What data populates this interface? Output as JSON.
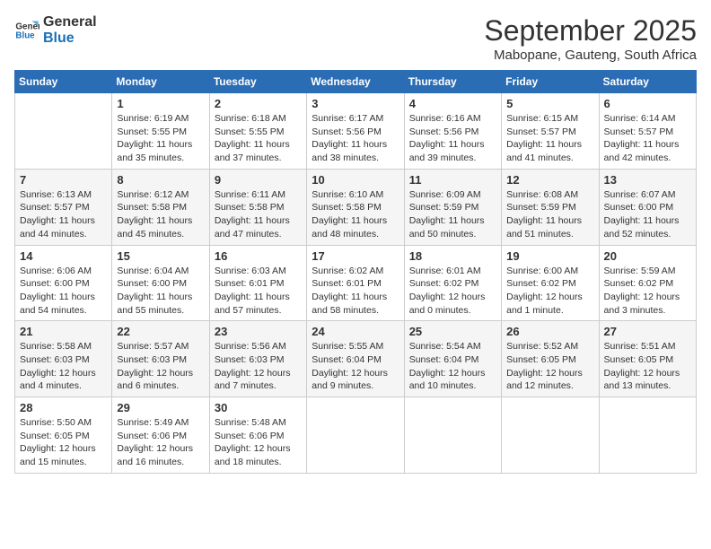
{
  "logo": {
    "line1": "General",
    "line2": "Blue"
  },
  "title": "September 2025",
  "location": "Mabopane, Gauteng, South Africa",
  "weekdays": [
    "Sunday",
    "Monday",
    "Tuesday",
    "Wednesday",
    "Thursday",
    "Friday",
    "Saturday"
  ],
  "weeks": [
    [
      {
        "day": "",
        "info": ""
      },
      {
        "day": "1",
        "info": "Sunrise: 6:19 AM\nSunset: 5:55 PM\nDaylight: 11 hours\nand 35 minutes."
      },
      {
        "day": "2",
        "info": "Sunrise: 6:18 AM\nSunset: 5:55 PM\nDaylight: 11 hours\nand 37 minutes."
      },
      {
        "day": "3",
        "info": "Sunrise: 6:17 AM\nSunset: 5:56 PM\nDaylight: 11 hours\nand 38 minutes."
      },
      {
        "day": "4",
        "info": "Sunrise: 6:16 AM\nSunset: 5:56 PM\nDaylight: 11 hours\nand 39 minutes."
      },
      {
        "day": "5",
        "info": "Sunrise: 6:15 AM\nSunset: 5:57 PM\nDaylight: 11 hours\nand 41 minutes."
      },
      {
        "day": "6",
        "info": "Sunrise: 6:14 AM\nSunset: 5:57 PM\nDaylight: 11 hours\nand 42 minutes."
      }
    ],
    [
      {
        "day": "7",
        "info": "Sunrise: 6:13 AM\nSunset: 5:57 PM\nDaylight: 11 hours\nand 44 minutes."
      },
      {
        "day": "8",
        "info": "Sunrise: 6:12 AM\nSunset: 5:58 PM\nDaylight: 11 hours\nand 45 minutes."
      },
      {
        "day": "9",
        "info": "Sunrise: 6:11 AM\nSunset: 5:58 PM\nDaylight: 11 hours\nand 47 minutes."
      },
      {
        "day": "10",
        "info": "Sunrise: 6:10 AM\nSunset: 5:58 PM\nDaylight: 11 hours\nand 48 minutes."
      },
      {
        "day": "11",
        "info": "Sunrise: 6:09 AM\nSunset: 5:59 PM\nDaylight: 11 hours\nand 50 minutes."
      },
      {
        "day": "12",
        "info": "Sunrise: 6:08 AM\nSunset: 5:59 PM\nDaylight: 11 hours\nand 51 minutes."
      },
      {
        "day": "13",
        "info": "Sunrise: 6:07 AM\nSunset: 6:00 PM\nDaylight: 11 hours\nand 52 minutes."
      }
    ],
    [
      {
        "day": "14",
        "info": "Sunrise: 6:06 AM\nSunset: 6:00 PM\nDaylight: 11 hours\nand 54 minutes."
      },
      {
        "day": "15",
        "info": "Sunrise: 6:04 AM\nSunset: 6:00 PM\nDaylight: 11 hours\nand 55 minutes."
      },
      {
        "day": "16",
        "info": "Sunrise: 6:03 AM\nSunset: 6:01 PM\nDaylight: 11 hours\nand 57 minutes."
      },
      {
        "day": "17",
        "info": "Sunrise: 6:02 AM\nSunset: 6:01 PM\nDaylight: 11 hours\nand 58 minutes."
      },
      {
        "day": "18",
        "info": "Sunrise: 6:01 AM\nSunset: 6:02 PM\nDaylight: 12 hours\nand 0 minutes."
      },
      {
        "day": "19",
        "info": "Sunrise: 6:00 AM\nSunset: 6:02 PM\nDaylight: 12 hours\nand 1 minute."
      },
      {
        "day": "20",
        "info": "Sunrise: 5:59 AM\nSunset: 6:02 PM\nDaylight: 12 hours\nand 3 minutes."
      }
    ],
    [
      {
        "day": "21",
        "info": "Sunrise: 5:58 AM\nSunset: 6:03 PM\nDaylight: 12 hours\nand 4 minutes."
      },
      {
        "day": "22",
        "info": "Sunrise: 5:57 AM\nSunset: 6:03 PM\nDaylight: 12 hours\nand 6 minutes."
      },
      {
        "day": "23",
        "info": "Sunrise: 5:56 AM\nSunset: 6:03 PM\nDaylight: 12 hours\nand 7 minutes."
      },
      {
        "day": "24",
        "info": "Sunrise: 5:55 AM\nSunset: 6:04 PM\nDaylight: 12 hours\nand 9 minutes."
      },
      {
        "day": "25",
        "info": "Sunrise: 5:54 AM\nSunset: 6:04 PM\nDaylight: 12 hours\nand 10 minutes."
      },
      {
        "day": "26",
        "info": "Sunrise: 5:52 AM\nSunset: 6:05 PM\nDaylight: 12 hours\nand 12 minutes."
      },
      {
        "day": "27",
        "info": "Sunrise: 5:51 AM\nSunset: 6:05 PM\nDaylight: 12 hours\nand 13 minutes."
      }
    ],
    [
      {
        "day": "28",
        "info": "Sunrise: 5:50 AM\nSunset: 6:05 PM\nDaylight: 12 hours\nand 15 minutes."
      },
      {
        "day": "29",
        "info": "Sunrise: 5:49 AM\nSunset: 6:06 PM\nDaylight: 12 hours\nand 16 minutes."
      },
      {
        "day": "30",
        "info": "Sunrise: 5:48 AM\nSunset: 6:06 PM\nDaylight: 12 hours\nand 18 minutes."
      },
      {
        "day": "",
        "info": ""
      },
      {
        "day": "",
        "info": ""
      },
      {
        "day": "",
        "info": ""
      },
      {
        "day": "",
        "info": ""
      }
    ]
  ]
}
